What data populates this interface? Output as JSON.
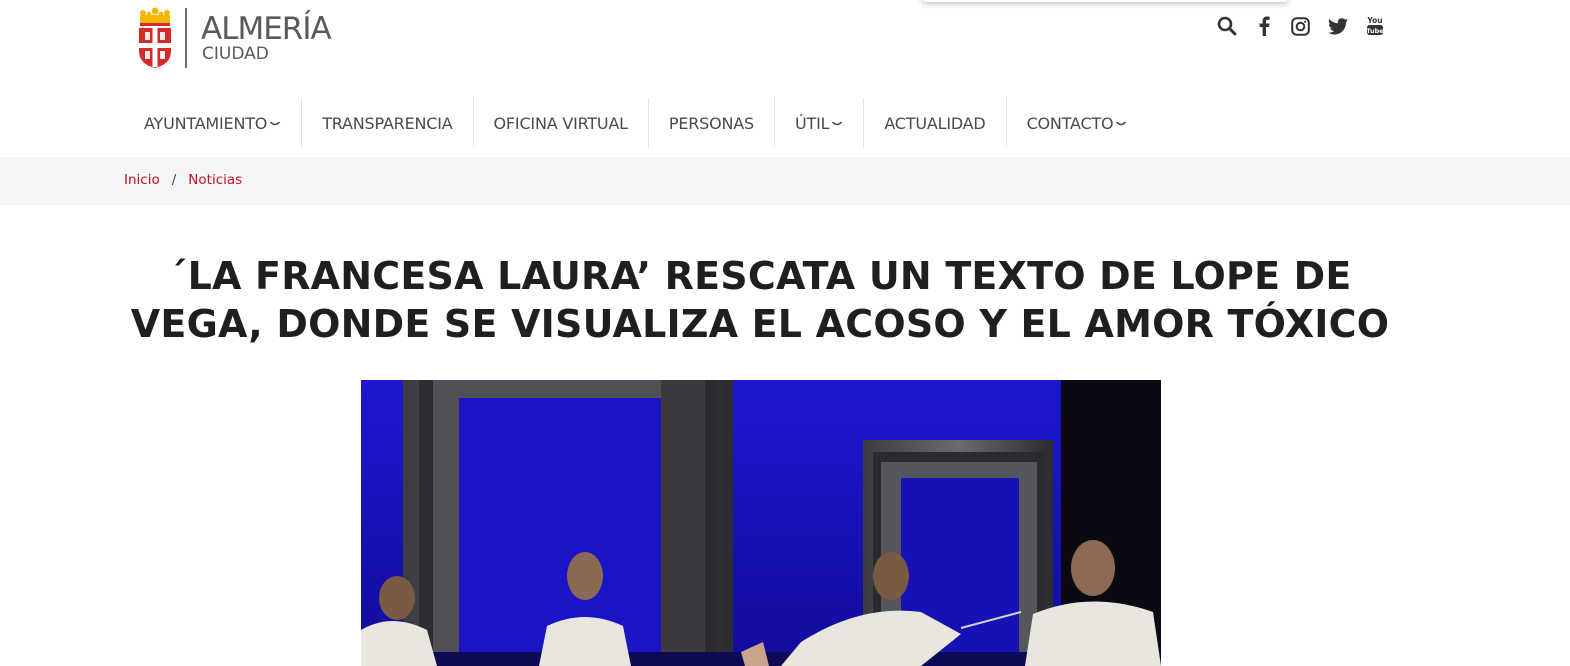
{
  "logo": {
    "title": "ALMERÍA",
    "subtitle": "CIUDAD"
  },
  "social": [
    {
      "icon": "search-icon"
    },
    {
      "icon": "facebook-icon"
    },
    {
      "icon": "instagram-icon"
    },
    {
      "icon": "twitter-icon"
    },
    {
      "icon": "youtube-icon"
    }
  ],
  "nav": {
    "items": [
      {
        "label": "AYUNTAMIENTO",
        "dropdown": true
      },
      {
        "label": "TRANSPARENCIA",
        "dropdown": false
      },
      {
        "label": "OFICINA VIRTUAL",
        "dropdown": false
      },
      {
        "label": "PERSONAS",
        "dropdown": false
      },
      {
        "label": "ÚTIL",
        "dropdown": true
      },
      {
        "label": "ACTUALIDAD",
        "dropdown": false
      },
      {
        "label": "CONTACTO",
        "dropdown": true
      }
    ]
  },
  "breadcrumb": {
    "home": "Inicio",
    "separator": "/",
    "current": "Noticias"
  },
  "article": {
    "title": "´LA FRANCESA LAURA’ RESCATA UN TEXTO DE LOPE DE VEGA, DONDE SE VISUALIZA EL ACOSO Y EL AMOR TÓXICO"
  },
  "colors": {
    "accent": "#c1121f",
    "stage_blue": "#1a12c8",
    "breadcrumb_bg": "#f5f5f5"
  }
}
